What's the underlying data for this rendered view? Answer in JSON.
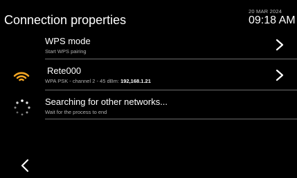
{
  "header": {
    "title": "Connection properties",
    "date": "20 MAR 2024",
    "time": "09:18 AM"
  },
  "rows": [
    {
      "title": "WPS mode",
      "subtitle": "Start WPS pairing",
      "icon": "chevron-right-icon"
    },
    {
      "title": "Rete000",
      "subtitle": "WPA PSK - channel 2 - 45 dBm: ",
      "ip": "192,168.1.21",
      "status_icon": "wifi-signal-icon",
      "icon": "chevron-right-icon"
    },
    {
      "title": "Searching for other networks...",
      "subtitle": "Wait for the process to end",
      "status_icon": "loading-spinner-icon"
    }
  ],
  "footer": {
    "back_icon": "chevron-left-icon"
  },
  "colors": {
    "accent": "#f5a623",
    "background": "#000000",
    "divider": "#6e6e6e"
  }
}
